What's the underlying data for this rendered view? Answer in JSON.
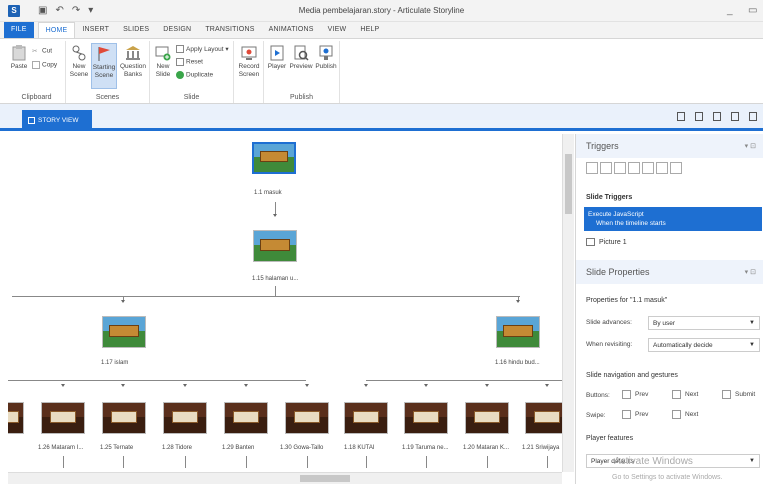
{
  "window": {
    "title": "Media pembelajaran.story - Articulate Storyline",
    "app_icon": "S",
    "controls": [
      "_",
      "▭"
    ]
  },
  "qat_icons": [
    "save-icon",
    "undo-icon",
    "redo-icon",
    "customize-icon"
  ],
  "ribbon_tabs": [
    {
      "label": "FILE"
    },
    {
      "label": "HOME"
    },
    {
      "label": "INSERT"
    },
    {
      "label": "SLIDES"
    },
    {
      "label": "DESIGN"
    },
    {
      "label": "TRANSITIONS"
    },
    {
      "label": "ANIMATIONS"
    },
    {
      "label": "VIEW"
    },
    {
      "label": "HELP"
    }
  ],
  "ribbon": {
    "clipboard": {
      "label": "Clipboard",
      "paste": "Paste",
      "cut": "Cut",
      "copy": "Copy"
    },
    "scenes": {
      "label": "Scenes",
      "new_scene": [
        "New",
        "Scene"
      ],
      "starting_scene": [
        "Starting",
        "Scene"
      ],
      "question_banks": [
        "Question",
        "Banks"
      ]
    },
    "slide": {
      "label": "Slide",
      "new_slide": [
        "New",
        "Slide"
      ],
      "apply_layout": "Apply Layout",
      "reset": "Reset",
      "duplicate": "Duplicate"
    },
    "record": [
      "Record",
      "Screen"
    ],
    "publish": {
      "label": "Publish",
      "player": "Player",
      "preview": "Preview",
      "publish": "Publish"
    }
  },
  "story_view_tab": "STORY VIEW",
  "slides": {
    "s1": "1.1 masuk",
    "s2": "1.15 halaman u...",
    "s3": "1.17 islam",
    "s4": "1.16 hindu bud...",
    "row": [
      "1.26 Mataram I...",
      "1.25 Ternate",
      "1.28 Tidore",
      "1.29 Banten",
      "1.30 Gowa-Tallo",
      "1.18 KUTAI",
      "1.19 Taruma ne...",
      "1.20 Mataran K...",
      "1.21 Sriwijaya"
    ]
  },
  "triggers_panel": {
    "title": "Triggers",
    "section": "Slide Triggers",
    "selected_trigger_line1": "Execute JavaScript",
    "selected_trigger_line2": "When the timeline starts",
    "object": "Picture 1"
  },
  "properties_panel": {
    "title": "Slide Properties",
    "header": "Properties for \"1.1 masuk\"",
    "slide_advances_label": "Slide advances:",
    "slide_advances_value": "By user",
    "when_revisiting_label": "When revisiting:",
    "when_revisiting_value": "Automatically decide",
    "nav_header": "Slide navigation and gestures",
    "buttons_label": "Buttons:",
    "swipe_label": "Swipe:",
    "prev": "Prev",
    "next": "Next",
    "submit": "Submit",
    "player_features": "Player features",
    "player_defaults": "Player defaults"
  },
  "watermark": {
    "line1": "Activate Windows",
    "line2": "Go to Settings to activate Windows."
  }
}
